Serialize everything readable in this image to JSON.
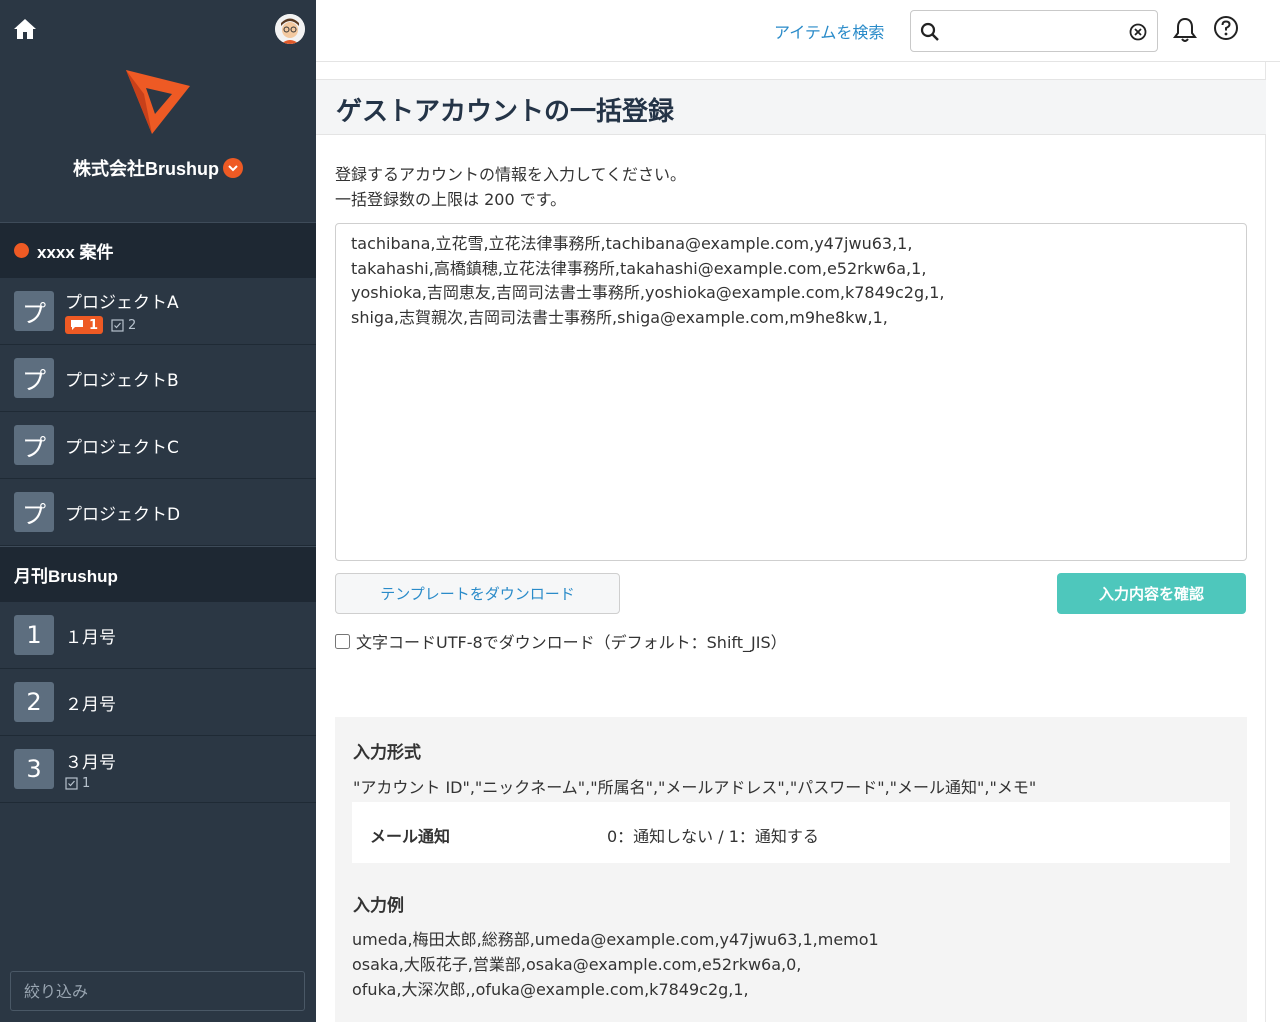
{
  "sidebar": {
    "company_name": "株式会社Brushup",
    "group1": {
      "title": "xxxx 案件",
      "items": [
        {
          "icon_char": "プ",
          "label": "プロジェクトA",
          "comments": "1",
          "tasks": "2"
        },
        {
          "icon_char": "プ",
          "label": "プロジェクトB"
        },
        {
          "icon_char": "プ",
          "label": "プロジェクトC"
        },
        {
          "icon_char": "プ",
          "label": "プロジェクトD"
        }
      ]
    },
    "group2": {
      "title": "月刊Brushup",
      "items": [
        {
          "icon_char": "1",
          "label": "１月号"
        },
        {
          "icon_char": "2",
          "label": "２月号"
        },
        {
          "icon_char": "3",
          "label": "３月号",
          "tasks": "1"
        }
      ]
    },
    "filter_placeholder": "絞り込み"
  },
  "topbar": {
    "search_link": "アイテムを検索",
    "search_value": ""
  },
  "main": {
    "title": "ゲストアカウントの一括登録",
    "desc_line1": "登録するアカウントの情報を入力してください。",
    "desc_line2": "一括登録数の上限は 200 です。",
    "bulk_text": "tachibana,立花雪,立花法律事務所,tachibana@example.com,y47jwu63,1,\ntakahashi,高橋鎮穂,立花法律事務所,takahashi@example.com,e52rkw6a,1,\nyoshioka,吉岡恵友,吉岡司法書士事務所,yoshioka@example.com,k7849c2g,1,\nshiga,志賀親次,吉岡司法書士事務所,shiga@example.com,m9he8kw,1,",
    "template_button": "テンプレートをダウンロード",
    "confirm_button": "入力内容を確認",
    "utf8_label": "文字コードUTF-8でダウンロード（デフォルト：Shift_JIS）"
  },
  "info": {
    "format_title": "入力形式",
    "format_line": "\"アカウント ID\",\"ニックネーム\",\"所属名\",\"メールアドレス\",\"パスワード\",\"メール通知\",\"メモ\"",
    "notify_label": "メール通知",
    "notify_value": "0：通知しない / 1：通知する",
    "example_title": "入力例",
    "examples": [
      "umeda,梅田太郎,総務部,umeda@example.com,y47jwu63,1,memo1",
      "osaka,大阪花子,営業部,osaka@example.com,e52rkw6a,0,",
      "ofuka,大深次郎,,ofuka@example.com,k7849c2g,1,"
    ]
  },
  "colors": {
    "sidebar_bg": "#2b3744",
    "accent_orange": "#ee5a24",
    "confirm_teal": "#4ec7bc",
    "link_blue": "#2a8bc9"
  }
}
